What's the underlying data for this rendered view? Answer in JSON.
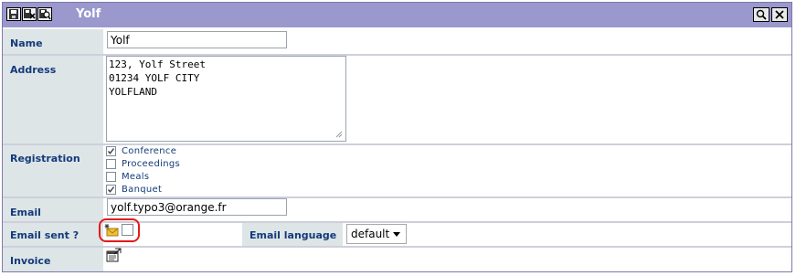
{
  "window": {
    "title": "Yolf",
    "toolbar_icons": [
      "save-icon",
      "save-and-close-icon",
      "save-and-preview-icon"
    ],
    "right_icons": [
      "zoom-icon",
      "close-icon"
    ]
  },
  "form": {
    "name": {
      "label": "Name",
      "value": "Yolf"
    },
    "address": {
      "label": "Address",
      "value": "123, Yolf Street\n01234 YOLF CITY\nYOLFLAND"
    },
    "registration": {
      "label": "Registration",
      "options": [
        {
          "label": "Conference",
          "checked": true
        },
        {
          "label": "Proceedings",
          "checked": false
        },
        {
          "label": "Meals",
          "checked": false
        },
        {
          "label": "Banquet",
          "checked": true
        }
      ]
    },
    "email": {
      "label": "Email",
      "value": "yolf.typo3@orange.fr"
    },
    "email_sent": {
      "label": "Email sent ?",
      "checked": false,
      "icon": "new-mail-icon"
    },
    "email_language": {
      "label": "Email language",
      "value": "default"
    },
    "invoice": {
      "label": "Invoice",
      "icon": "invoice-edit-icon"
    }
  },
  "colors": {
    "titlebar": "#9a98cd",
    "label_bg": "#dde5e7",
    "label_text": "#143a7a",
    "highlight": "#e21b1b"
  }
}
